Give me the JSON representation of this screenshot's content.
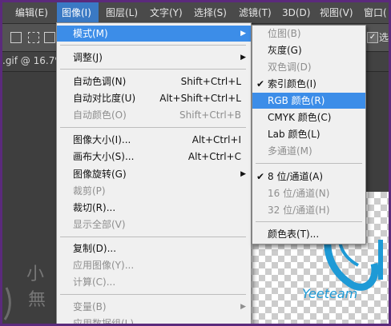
{
  "menubar": {
    "items": [
      "编辑(E)",
      "图像(I)",
      "图层(L)",
      "文字(Y)",
      "选择(S)",
      "滤镜(T)",
      "3D(D)",
      "视图(V)",
      "窗口("
    ]
  },
  "options_bar": {
    "checkbox_label": "选"
  },
  "document_tab": {
    "label": ".gif @ 16.7%"
  },
  "image_menu": {
    "items": [
      {
        "label": "模式(M)",
        "submenu": true,
        "highlighted": true
      },
      {
        "label": "调整(J)",
        "submenu": true
      },
      {
        "label": "自动色调(N)",
        "shortcut": "Shift+Ctrl+L"
      },
      {
        "label": "自动对比度(U)",
        "shortcut": "Alt+Shift+Ctrl+L"
      },
      {
        "label": "自动颜色(O)",
        "shortcut": "Shift+Ctrl+B",
        "disabled": true
      },
      {
        "label": "图像大小(I)...",
        "shortcut": "Alt+Ctrl+I"
      },
      {
        "label": "画布大小(S)...",
        "shortcut": "Alt+Ctrl+C"
      },
      {
        "label": "图像旋转(G)",
        "submenu": true
      },
      {
        "label": "裁剪(P)",
        "disabled": true
      },
      {
        "label": "裁切(R)..."
      },
      {
        "label": "显示全部(V)",
        "disabled": true
      },
      {
        "label": "复制(D)..."
      },
      {
        "label": "应用图像(Y)...",
        "disabled": true
      },
      {
        "label": "计算(C)...",
        "disabled": true
      },
      {
        "label": "变量(B)",
        "submenu": true,
        "disabled": true
      },
      {
        "label": "应用数据组(L)...",
        "disabled": true
      }
    ]
  },
  "mode_submenu": {
    "items": [
      {
        "label": "位图(B)",
        "disabled": true
      },
      {
        "label": "灰度(G)"
      },
      {
        "label": "双色调(D)",
        "disabled": true
      },
      {
        "label": "索引颜色(I)",
        "checked": true
      },
      {
        "label": "RGB 颜色(R)",
        "highlighted": true
      },
      {
        "label": "CMYK 颜色(C)"
      },
      {
        "label": "Lab 颜色(L)"
      },
      {
        "label": "多通道(M)",
        "disabled": true
      },
      {
        "label": "8 位/通道(A)",
        "checked": true
      },
      {
        "label": "16 位/通道(N)",
        "disabled": true
      },
      {
        "label": "32 位/通道(H)",
        "disabled": true
      },
      {
        "label": "颜色表(T)..."
      }
    ]
  },
  "artwork": {
    "text": "Yeeteam"
  },
  "watermark": {
    "chars": [
      "小",
      "無"
    ]
  },
  "colors": {
    "menu_highlight": "#3c8de8",
    "menubar_active": "#3a79c4",
    "frame": "#5b2a7c",
    "accent_art": "#1e9ad6"
  }
}
